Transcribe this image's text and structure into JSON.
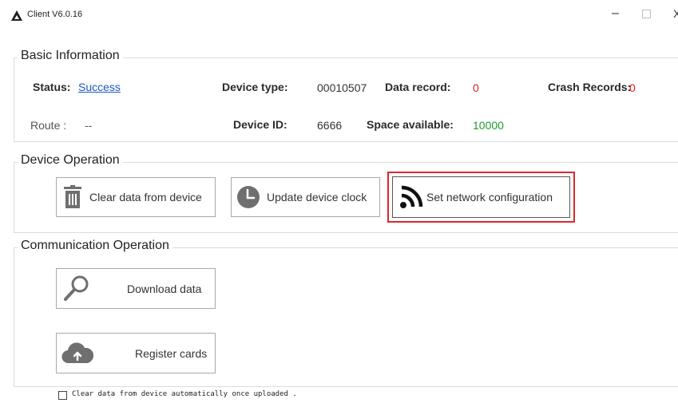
{
  "window": {
    "title": "Client V6.0.16",
    "minimize": "–",
    "close": "X"
  },
  "basic_info": {
    "title": "Basic Information",
    "status_label": "Status:",
    "status_value": "Success",
    "device_type_label": "Device type:",
    "device_type_value": "00010507",
    "data_record_label": "Data record:",
    "data_record_value": "0",
    "crash_records_label": "Crash Records:",
    "crash_records_value": "0",
    "route_label": "Route :",
    "route_value": "--",
    "device_id_label": "Device ID:",
    "device_id_value": "6666",
    "space_label": "Space available:",
    "space_value": "10000"
  },
  "device_operation": {
    "title": "Device Operation",
    "clear_label": "Clear data from device",
    "update_clock_label": "Update device clock",
    "network_label": "Set network configuration"
  },
  "communication_operation": {
    "title": "Communication Operation",
    "download_label": "Download data",
    "register_label": "Register cards"
  },
  "auto_clear": {
    "label": "Clear data from device automatically once uploaded .",
    "checked": false
  },
  "colors": {
    "accent_red": "#e0262b",
    "link_blue": "#1a57c2",
    "value_green": "#1e9b2a",
    "value_red": "#e11b1b"
  },
  "icons": [
    "app-logo-icon",
    "trash-icon",
    "clock-icon",
    "wifi-signal-icon",
    "search-magnifier-icon",
    "cloud-upload-icon"
  ]
}
